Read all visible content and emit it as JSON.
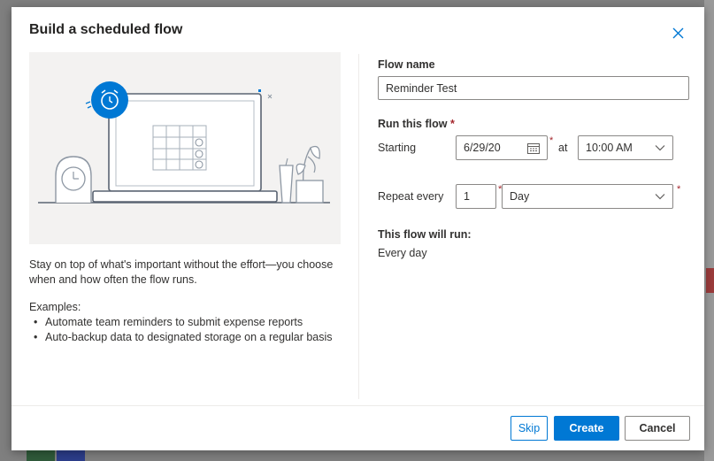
{
  "dialog": {
    "title": "Build a scheduled flow",
    "close_icon": "close-icon"
  },
  "left": {
    "description": "Stay on top of what's important without the effort—you choose when and how often the flow runs.",
    "examples_heading": "Examples:",
    "examples": [
      "Automate team reminders to submit expense reports",
      "Auto-backup data to designated storage on a regular basis"
    ]
  },
  "form": {
    "flow_name_label": "Flow name",
    "flow_name_value": "Reminder Test",
    "run_label": "Run this flow",
    "required_mark": "*",
    "starting_label": "Starting",
    "start_date": "6/29/20",
    "at_label": "at",
    "start_time": "10:00 AM",
    "repeat_label": "Repeat every",
    "repeat_interval": "1",
    "repeat_unit": "Day",
    "will_run_label": "This flow will run:",
    "will_run_value": "Every day"
  },
  "footer": {
    "skip_label": "Skip",
    "create_label": "Create",
    "cancel_label": "Cancel"
  },
  "colors": {
    "accent": "#0078d4",
    "required": "#a4262c"
  }
}
